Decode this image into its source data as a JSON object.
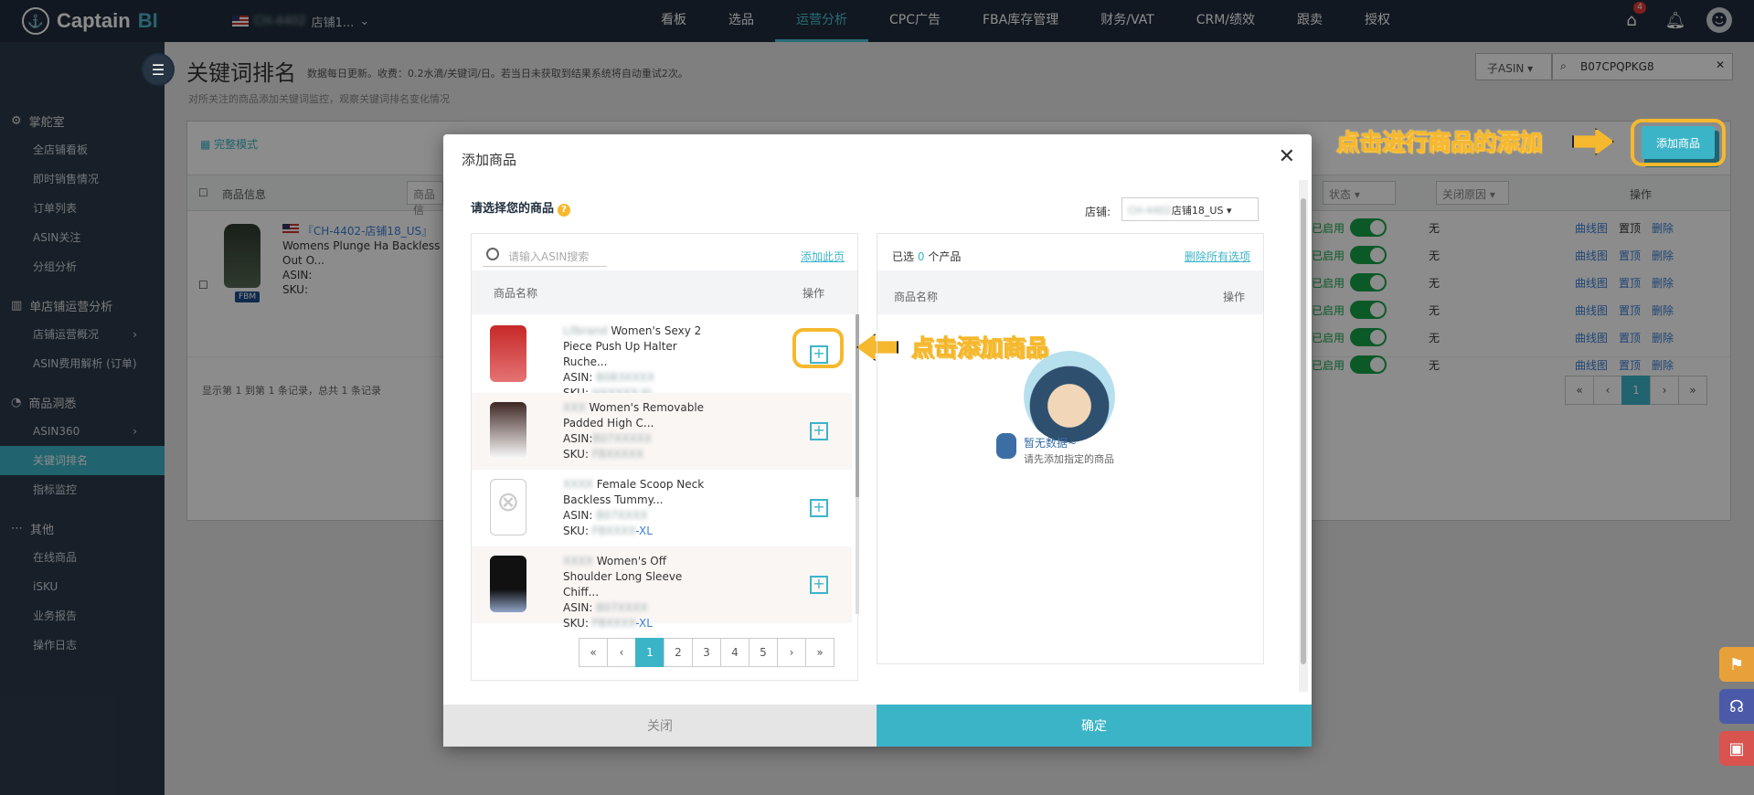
{
  "app": {
    "brand_prefix": "Captain",
    "brand_suffix": "BI",
    "store_name": "店铺1...",
    "store_blur": "CH-4402"
  },
  "nav": [
    {
      "label": "看板"
    },
    {
      "label": "选品"
    },
    {
      "label": "运营分析",
      "active": true
    },
    {
      "label": "CPC广告"
    },
    {
      "label": "FBA库存管理"
    },
    {
      "label": "财务/VAT"
    },
    {
      "label": "CRM/绩效"
    },
    {
      "label": "跟卖"
    },
    {
      "label": "授权"
    }
  ],
  "top_icons": {
    "notify_badge": "4"
  },
  "sidebar": {
    "sections": [
      {
        "title": "掌舵室",
        "icon": "gear-icon",
        "items": [
          "全店铺看板",
          "即时销售情况",
          "订单列表",
          "ASIN关注",
          "分组分析"
        ]
      },
      {
        "title": "单店铺运营分析",
        "icon": "bar-chart-icon",
        "items": [
          "店铺运营概况",
          "ASIN费用解析 (订单)"
        ]
      },
      {
        "title": "商品洞悉",
        "icon": "pie-icon",
        "items": [
          "ASIN360",
          "关键词排名",
          "指标监控"
        ]
      },
      {
        "title": "其他",
        "icon": "more-icon",
        "items": [
          "在线商品",
          "iSKU",
          "业务报告",
          "操作日志"
        ]
      }
    ]
  },
  "page": {
    "title": "关键词排名",
    "note": "数据每日更新。收费：0.2水滴/关键词/日。若当日未获取到结果系统将自动重试2次。",
    "subtitle": "对所关注的商品添加关键词监控，观察关键词排名变化情况",
    "asin_type": "子ASIN",
    "asin_search_value": "B07CPQPKG8",
    "mode_label": "完整模式",
    "add_button": "添加商品",
    "headers": {
      "product_info": "商品信息",
      "product_filter": "商品信",
      "status": "状态",
      "close_reason": "关闭原因",
      "ops": "操作"
    },
    "product": {
      "store": "『CH-4402-店铺18_US』",
      "title": "Womens Plunge Ha Backless Cut Out O...",
      "asin_label": "ASIN:",
      "sku_label": "SKU:",
      "fbm": "FBM"
    },
    "status_rows": [
      {
        "status": "已启用",
        "reason": "无",
        "chart": "曲线图",
        "pin": "置顶",
        "del": "删除"
      },
      {
        "status": "已启用",
        "reason": "无",
        "chart": "曲线图",
        "pin": "置顶",
        "del": "删除"
      },
      {
        "status": "已启用",
        "reason": "无",
        "chart": "曲线图",
        "pin": "置顶",
        "del": "删除"
      },
      {
        "status": "已启用",
        "reason": "无",
        "chart": "曲线图",
        "pin": "置顶",
        "del": "删除"
      },
      {
        "status": "已启用",
        "reason": "无",
        "chart": "曲线图",
        "pin": "置顶",
        "del": "删除"
      },
      {
        "status": "已启用",
        "reason": "无",
        "chart": "曲线图",
        "pin": "置顶",
        "del": "删除"
      }
    ],
    "records": "显示第 1 到第 1 条记录，总共 1 条记录",
    "pager": [
      "«",
      "‹",
      "1",
      "›",
      "»"
    ]
  },
  "callouts": {
    "top": "点击进行商品的添加",
    "mid": "点击添加商品"
  },
  "modal": {
    "title": "添加商品",
    "choose_label": "请选择您的商品",
    "store_label": "店铺:",
    "store_value": "店铺18_US",
    "search_placeholder": "请输入ASIN搜索",
    "add_page": "添加此页",
    "col_name": "商品名称",
    "col_op": "操作",
    "products": [
      {
        "name": "Women's Sexy 2 Piece Push Up Halter Ruche...",
        "asin": "ASIN:",
        "sku": "SKU:",
        "sku_suffix": ""
      },
      {
        "name": "Women's Removable Padded High C...",
        "asin": "ASIN:",
        "sku": "SKU:",
        "sku_suffix": ""
      },
      {
        "name": "Female Scoop Neck Backless Tummy...",
        "asin": "ASIN:",
        "sku": "SKU:",
        "sku_suffix": "-XL"
      },
      {
        "name": "Women's Off Shoulder Long Sleeve Chiff...",
        "asin": "ASIN:",
        "sku": "SKU:",
        "sku_suffix": "-XL"
      }
    ],
    "pager": [
      "«",
      "‹",
      "1",
      "2",
      "3",
      "4",
      "5",
      "›",
      "»"
    ],
    "selected_prefix": "已选",
    "selected_count": "0",
    "selected_suffix": "个产品",
    "delete_all": "删除所有选项",
    "empty_title": "暂无数据~",
    "empty_hint": "请先添加指定的商品",
    "close_btn": "关闭",
    "ok_btn": "确定"
  }
}
